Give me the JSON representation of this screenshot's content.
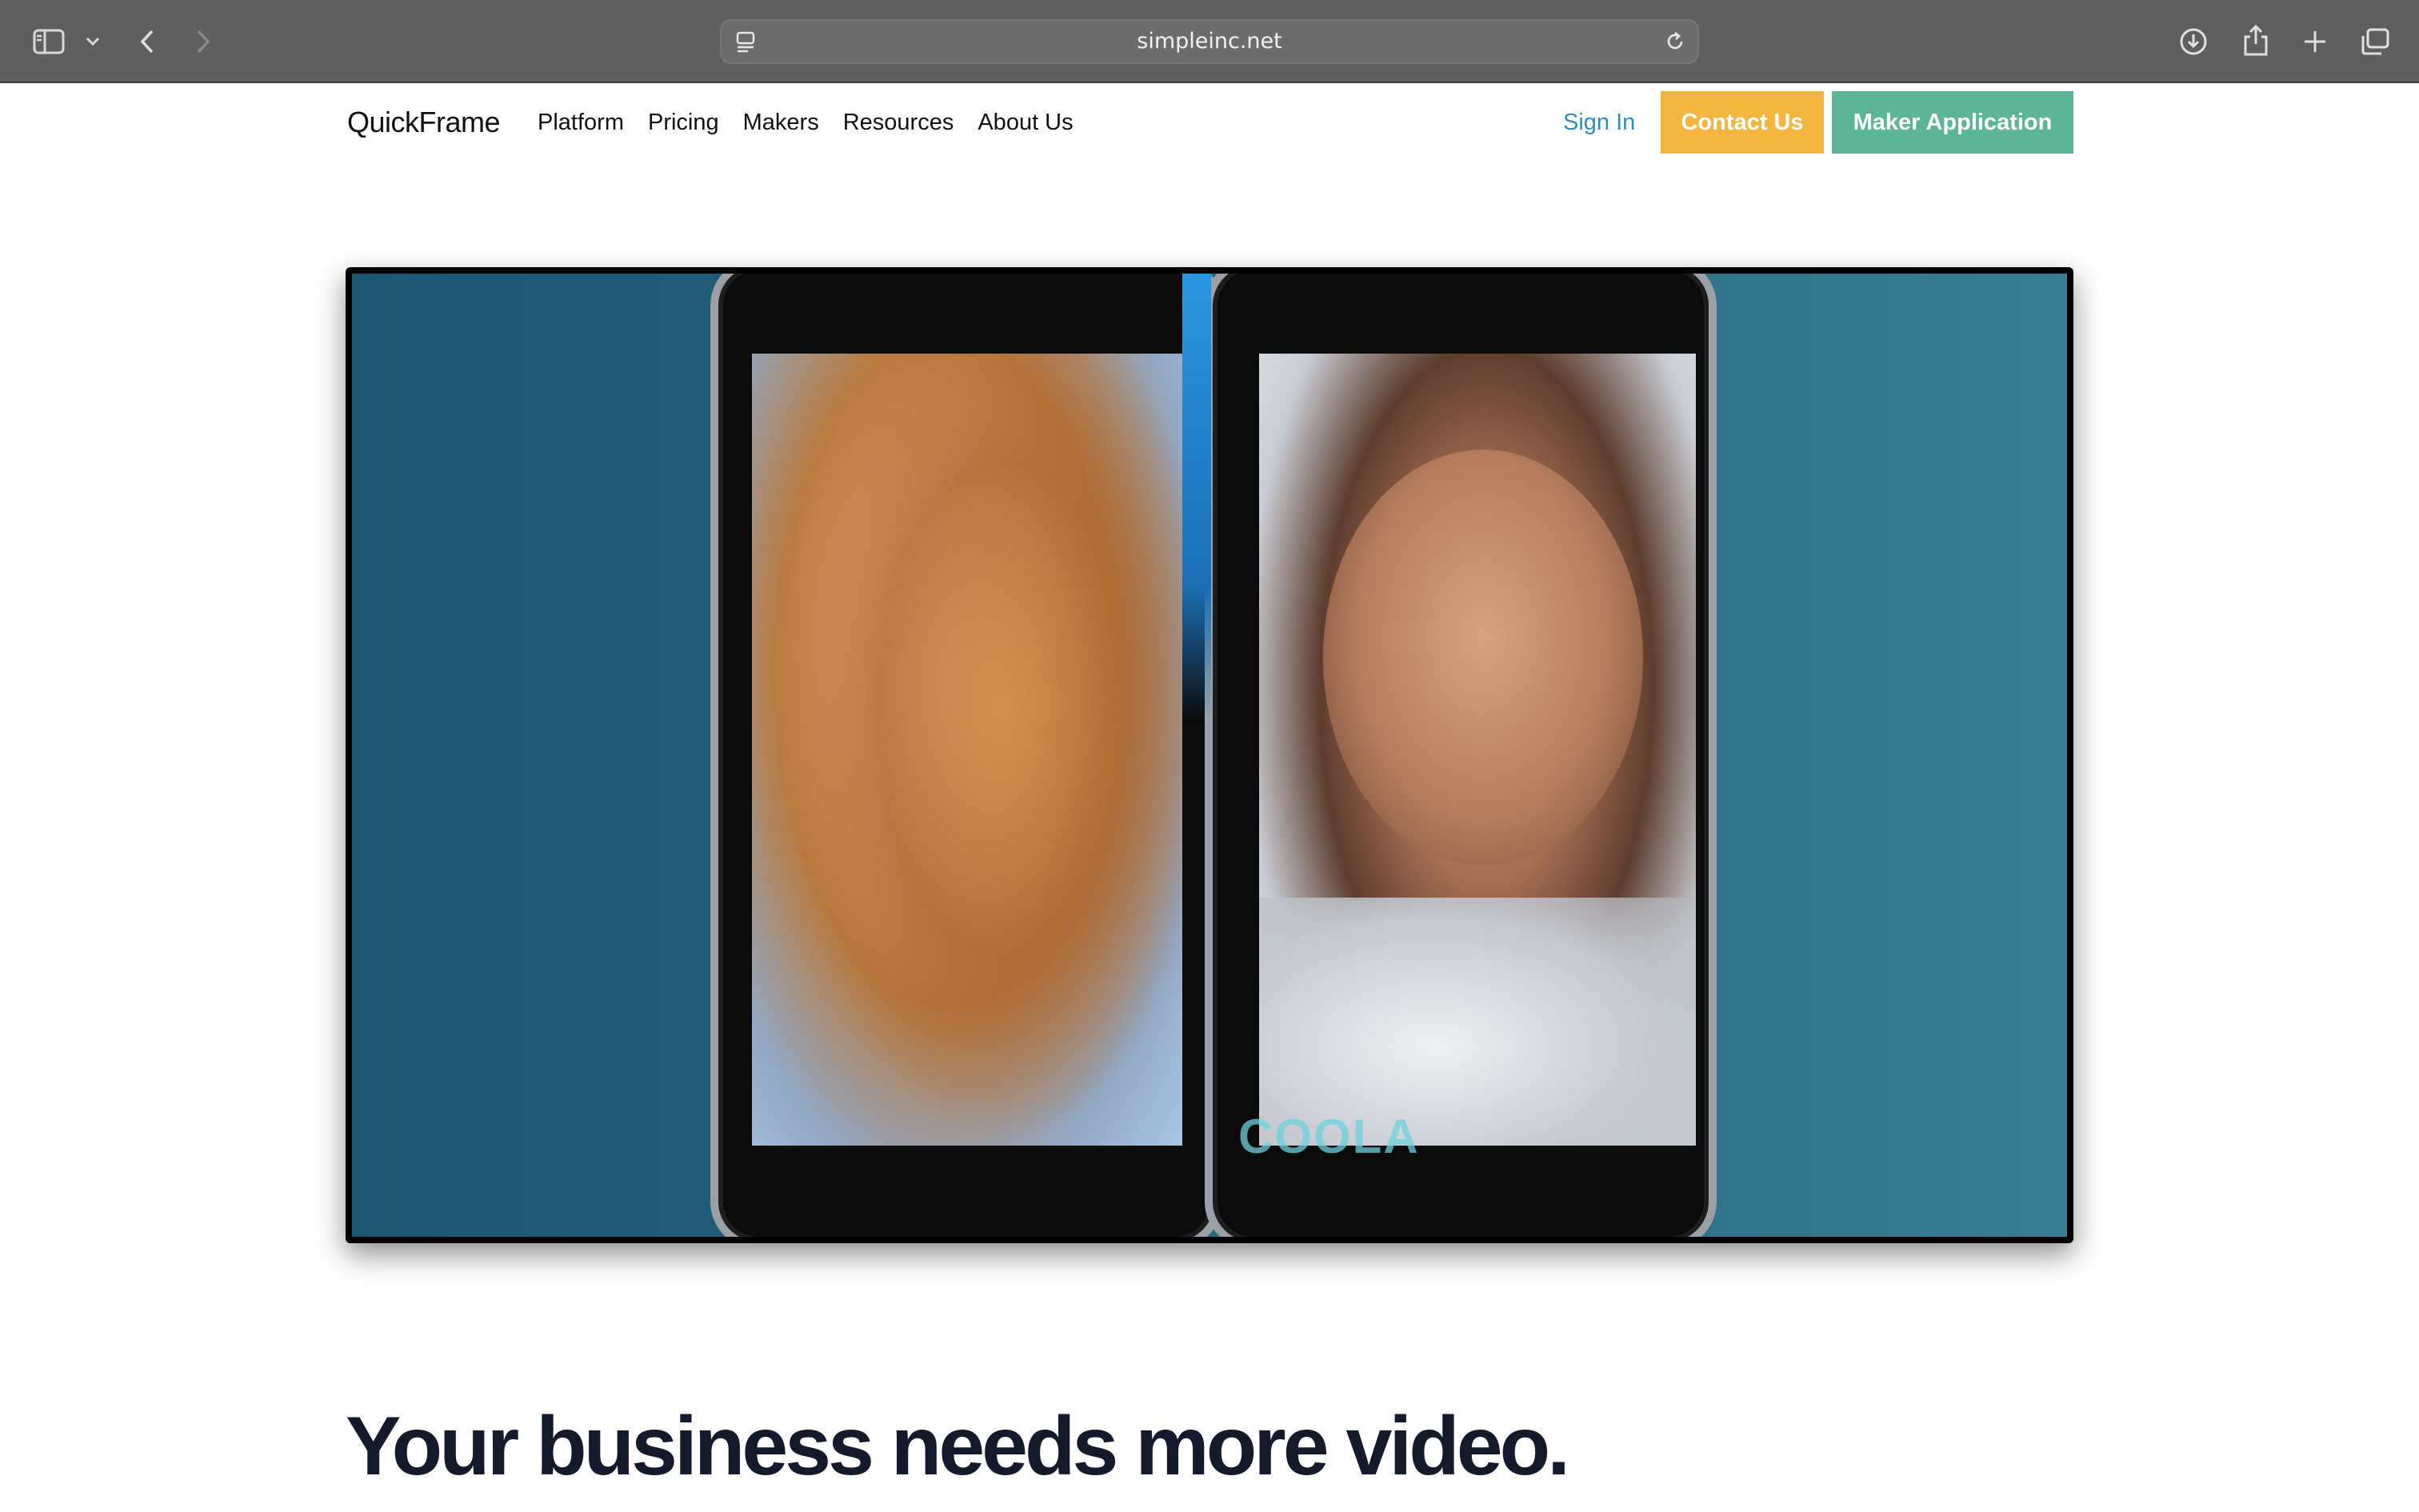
{
  "browser": {
    "url": "simpleinc.net",
    "icons": {
      "sidebar": "sidebar-icon",
      "tab_group_menu": "chevron-down-icon",
      "back": "chevron-left-icon",
      "forward": "chevron-right-icon",
      "page_menu": "page-menu-icon",
      "reload": "reload-icon",
      "downloads": "download-icon",
      "share": "share-icon",
      "new_tab": "plus-icon",
      "tab_overview": "tabs-icon"
    }
  },
  "nav": {
    "logo": "QuickFrame",
    "links": [
      "Platform",
      "Pricing",
      "Makers",
      "Resources",
      "About Us"
    ],
    "sign_in": "Sign In",
    "contact": "Contact Us",
    "maker_application": "Maker Application"
  },
  "hero": {
    "overlay_brand": "COOLA"
  },
  "headline": "Your business needs more video.",
  "colors": {
    "toolbar": "#5f5f5f",
    "sign_in": "#2e8dbd",
    "contact_button": "#f2b53f",
    "maker_button": "#5cb597",
    "headline": "#141a2a"
  }
}
